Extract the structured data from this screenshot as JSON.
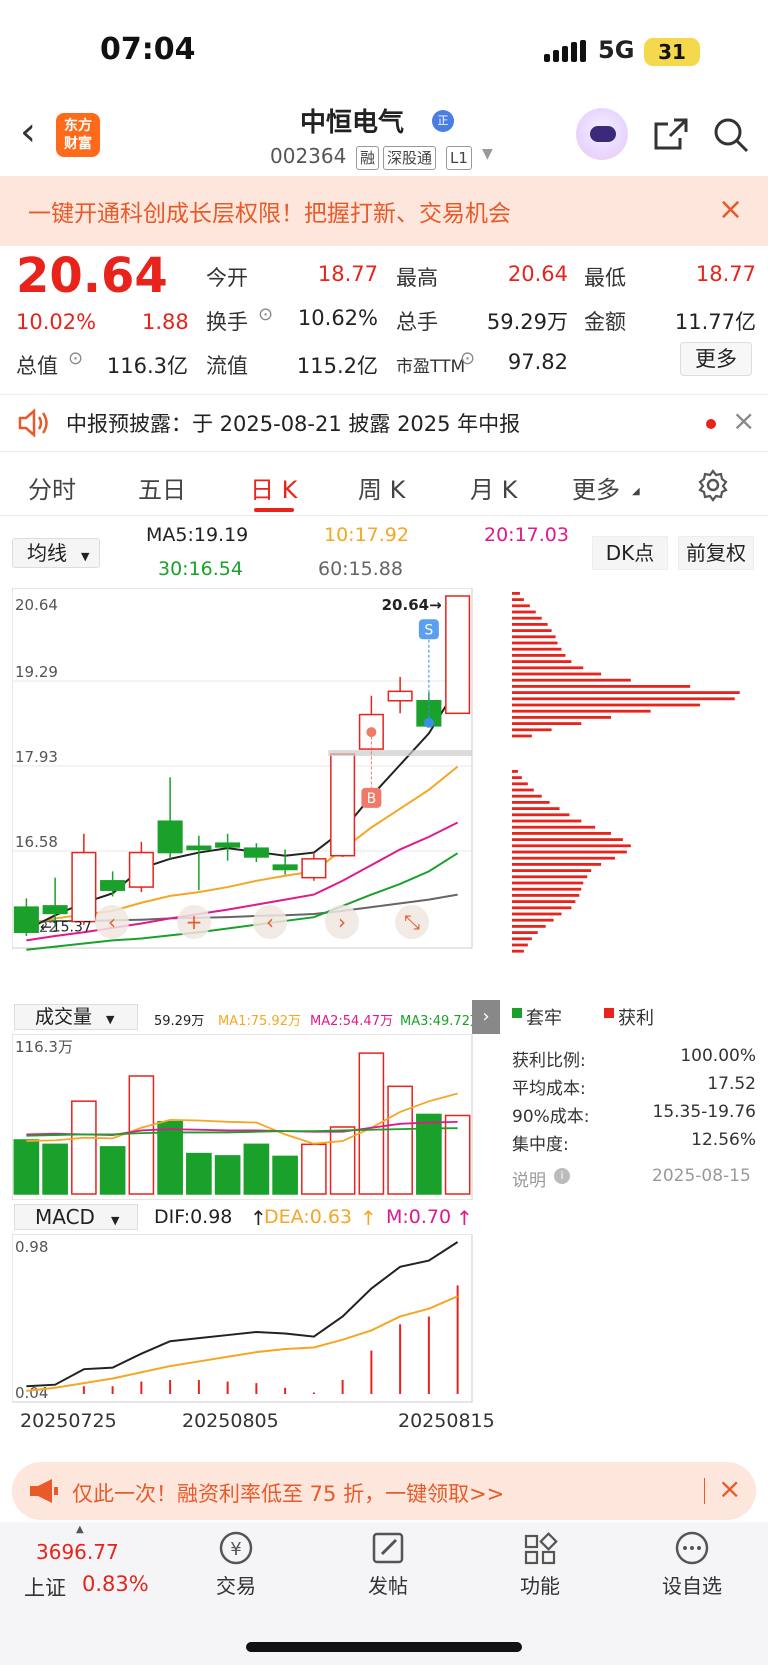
{
  "status_bar": {
    "time": "07:04",
    "network": "5G",
    "battery": "31"
  },
  "header": {
    "logo_text": "东方\n财富",
    "stock_name": "中恒电气",
    "name_badge": "正",
    "stock_code": "002364",
    "tags": [
      "融",
      "深股通",
      "L1"
    ]
  },
  "banner": {
    "text": "一键开通科创成长层权限！把握打新、交易机会"
  },
  "quote": {
    "price": "20.64",
    "change_pct": "10.02%",
    "change": "1.88",
    "items": [
      {
        "label": "今开",
        "value": "18.77",
        "color": "red"
      },
      {
        "label": "最高",
        "value": "20.64",
        "color": "red"
      },
      {
        "label": "最低",
        "value": "18.77",
        "color": "red"
      },
      {
        "label": "换手",
        "value": "10.62%",
        "color": "black"
      },
      {
        "label": "总手",
        "value": "59.29万",
        "color": "black"
      },
      {
        "label": "金额",
        "value": "11.77亿",
        "color": "black"
      },
      {
        "label": "总值",
        "value": "116.3亿",
        "color": "black"
      },
      {
        "label": "流值",
        "value": "115.2亿",
        "color": "black"
      },
      {
        "label": "市盈TTM",
        "value": "97.82",
        "color": "black"
      }
    ],
    "more_label": "更多"
  },
  "notice": {
    "text": "中报预披露：于 2025-08-21 披露 2025 年中报"
  },
  "tabs": [
    {
      "label": "分时"
    },
    {
      "label": "五日"
    },
    {
      "label": "日 K"
    },
    {
      "label": "周 K"
    },
    {
      "label": "月 K"
    },
    {
      "label": "更多"
    }
  ],
  "chart_controls": {
    "ma_select": "均线",
    "ma5": "MA5:19.19",
    "ma10": "10:17.92",
    "ma20": "20:17.03",
    "ma30": "30:16.54",
    "ma60": "60:15.88",
    "dk_button": "DK点",
    "fuquan_button": "前复权"
  },
  "colors": {
    "up": "#e8231c",
    "down": "#1aa12b",
    "ma5": "#222222",
    "ma10": "#f5a623",
    "ma20": "#e0198c",
    "ma30": "#1aa12b",
    "ma60": "#666666"
  },
  "chart_data": [
    {
      "type": "candlestick",
      "y_ticks": [
        "20.64",
        "19.29",
        "17.93",
        "16.58",
        "15.22"
      ],
      "ylim": [
        15.22,
        20.64
      ],
      "high_label": "20.64",
      "low_label": "15.37",
      "candles": [
        {
          "o": 15.68,
          "c": 15.28,
          "h": 15.82,
          "l": 15.22
        },
        {
          "o": 15.7,
          "c": 15.58,
          "h": 16.15,
          "l": 15.4
        },
        {
          "o": 15.45,
          "c": 16.55,
          "h": 16.85,
          "l": 15.4
        },
        {
          "o": 16.1,
          "c": 15.95,
          "h": 16.25,
          "l": 15.85
        },
        {
          "o": 16.0,
          "c": 16.55,
          "h": 16.72,
          "l": 15.92
        },
        {
          "o": 17.05,
          "c": 16.55,
          "h": 17.75,
          "l": 16.45
        },
        {
          "o": 16.65,
          "c": 16.6,
          "h": 16.82,
          "l": 15.95
        },
        {
          "o": 16.7,
          "c": 16.64,
          "h": 16.85,
          "l": 16.42
        },
        {
          "o": 16.62,
          "c": 16.48,
          "h": 16.7,
          "l": 16.4
        },
        {
          "o": 16.35,
          "c": 16.28,
          "h": 16.6,
          "l": 16.2
        },
        {
          "o": 16.15,
          "c": 16.45,
          "h": 16.55,
          "l": 16.1
        },
        {
          "o": 16.5,
          "c": 18.12,
          "h": 18.12,
          "l": 16.48
        },
        {
          "o": 18.2,
          "c": 18.75,
          "h": 19.05,
          "l": 18.18
        },
        {
          "o": 18.97,
          "c": 19.12,
          "h": 19.35,
          "l": 18.77
        },
        {
          "o": 18.97,
          "c": 18.57,
          "h": 19.1,
          "l": 18.55
        },
        {
          "o": 18.77,
          "c": 20.64,
          "h": 20.64,
          "l": 18.77
        }
      ],
      "ma_lines": {
        "ma5": [
          15.32,
          15.55,
          15.75,
          15.9,
          16.3,
          16.45,
          16.55,
          16.62,
          16.56,
          16.5,
          16.55,
          16.9,
          17.45,
          17.95,
          18.45,
          19.19
        ],
        "ma10": [
          15.4,
          15.5,
          15.56,
          15.62,
          15.75,
          15.86,
          15.92,
          16.0,
          16.1,
          16.18,
          16.25,
          16.6,
          16.95,
          17.25,
          17.55,
          17.92
        ],
        "ma20": [
          15.15,
          15.22,
          15.28,
          15.35,
          15.42,
          15.5,
          15.57,
          15.64,
          15.72,
          15.8,
          15.88,
          16.1,
          16.35,
          16.6,
          16.8,
          17.03
        ],
        "ma30": [
          15.0,
          15.05,
          15.1,
          15.15,
          15.18,
          15.23,
          15.28,
          15.34,
          15.4,
          15.46,
          15.52,
          15.7,
          15.88,
          16.05,
          16.25,
          16.54
        ],
        "ma60": [
          15.45,
          15.46,
          15.46,
          15.47,
          15.48,
          15.5,
          15.51,
          15.52,
          15.54,
          15.55,
          15.57,
          15.62,
          15.68,
          15.74,
          15.8,
          15.88
        ]
      }
    },
    {
      "type": "bar",
      "name": "成交量",
      "y_max_label": "116.3万",
      "values": [
        40.8,
        37.5,
        70.1,
        35.6,
        89.1,
        54.6,
        30.5,
        28.8,
        37.5,
        28.4,
        37.5,
        50.6,
        106.4,
        81.3,
        60.1,
        59.29
      ],
      "ma1": [
        40.0,
        40.5,
        42.5,
        42.0,
        50.0,
        56.0,
        55.5,
        54.5,
        54.0,
        45.0,
        38.0,
        40.0,
        50.0,
        62.0,
        70.0,
        75.92
      ],
      "ma2": [
        45.0,
        45.5,
        45.0,
        44.5,
        48.0,
        49.0,
        48.5,
        48.0,
        48.0,
        47.5,
        47.0,
        47.0,
        50.0,
        53.0,
        54.0,
        54.47
      ],
      "ma3": [
        44.0,
        44.5,
        45.0,
        45.0,
        46.0,
        46.5,
        46.5,
        46.5,
        47.0,
        47.5,
        47.5,
        48.0,
        48.5,
        49.0,
        49.5,
        49.72
      ]
    },
    {
      "type": "bar",
      "name": "MACD",
      "y_ticks": [
        "0.98",
        "0.04"
      ],
      "x_labels": [
        "20250725",
        "20250805",
        "20250815"
      ],
      "macd": [
        0.0,
        0.0,
        0.05,
        0.05,
        0.08,
        0.09,
        0.09,
        0.08,
        0.07,
        0.04,
        0.01,
        0.09,
        0.28,
        0.45,
        0.5,
        0.7
      ],
      "dif": [
        0.05,
        0.06,
        0.16,
        0.17,
        0.26,
        0.34,
        0.36,
        0.38,
        0.4,
        0.39,
        0.37,
        0.5,
        0.68,
        0.82,
        0.86,
        0.98
      ],
      "dea": [
        0.02,
        0.04,
        0.07,
        0.1,
        0.14,
        0.18,
        0.21,
        0.24,
        0.27,
        0.29,
        0.3,
        0.35,
        0.41,
        0.5,
        0.55,
        0.63
      ]
    }
  ],
  "volume_header": {
    "select": "成交量",
    "vol": "59.29万",
    "ma1": "MA1:75.92万",
    "ma2": "MA2:54.47万",
    "ma3": "MA3:49.72万"
  },
  "macd_header": {
    "select": "MACD",
    "dif": "DIF:0.98",
    "dea": "DEA:0.63",
    "m": "M:0.70"
  },
  "chip": {
    "legend_trap": "套牢",
    "legend_profit": "获利",
    "stats": [
      {
        "label": "获利比例:",
        "value": "100.00%"
      },
      {
        "label": "平均成本:",
        "value": "17.52"
      },
      {
        "label": "90%成本:",
        "value": "15.35-19.76"
      },
      {
        "label": "集中度:",
        "value": "12.56%"
      }
    ],
    "note_label": "说明",
    "date": "2025-08-15",
    "bars_upper": [
      8,
      12,
      18,
      24,
      30,
      36,
      40,
      44,
      46,
      50,
      54,
      60,
      72,
      90,
      120,
      180,
      230,
      225,
      190,
      140,
      100,
      70,
      40,
      20
    ],
    "bars_lower": [
      6,
      10,
      16,
      22,
      30,
      38,
      48,
      58,
      70,
      84,
      100,
      112,
      120,
      116,
      104,
      90,
      80,
      76,
      72,
      70,
      68,
      64,
      60,
      50,
      42,
      34,
      26,
      20,
      16,
      12
    ]
  },
  "promo": {
    "text": "仅此一次！融资利率低至 75 折，一键领取>>"
  },
  "bottom_bar": {
    "index_value": "3696.77",
    "index_name": "上证",
    "index_pct": "0.83%",
    "items": [
      {
        "label": "交易"
      },
      {
        "label": "发帖"
      },
      {
        "label": "功能"
      },
      {
        "label": "设自选"
      }
    ]
  }
}
